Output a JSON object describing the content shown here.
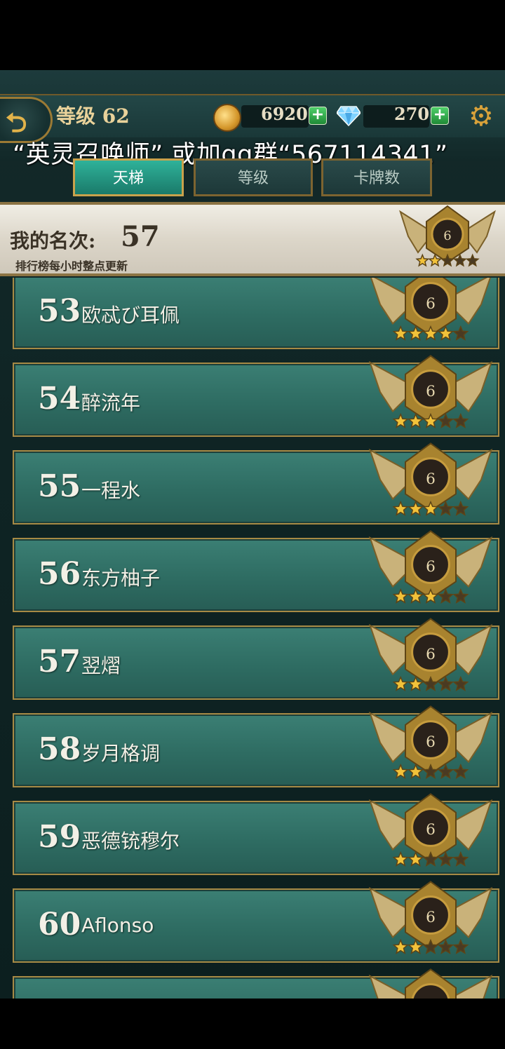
{
  "header": {
    "level_label": "等级 62",
    "gold": "6920",
    "gems": "270",
    "overlay_text": "“英灵召唤师” 或加qq群“567114341”"
  },
  "tabs": [
    {
      "label": "天梯",
      "active": true
    },
    {
      "label": "等级",
      "active": false
    },
    {
      "label": "卡牌数",
      "active": false
    }
  ],
  "my_rank": {
    "label": "我的名次:",
    "value": "57",
    "note": "排行榜每小时整点更新",
    "badge_level": "6",
    "stars_filled": 2,
    "stars_total": 5
  },
  "rows": [
    {
      "rank": "53",
      "name": "欧忒び耳佩",
      "badge_level": "6",
      "stars_filled": 4
    },
    {
      "rank": "54",
      "name": "醉流年",
      "badge_level": "6",
      "stars_filled": 3
    },
    {
      "rank": "55",
      "name": "一程水",
      "badge_level": "6",
      "stars_filled": 3
    },
    {
      "rank": "56",
      "name": "东方柚子",
      "badge_level": "6",
      "stars_filled": 3
    },
    {
      "rank": "57",
      "name": "翌熠",
      "badge_level": "6",
      "stars_filled": 2
    },
    {
      "rank": "58",
      "name": "岁月格调",
      "badge_level": "6",
      "stars_filled": 2
    },
    {
      "rank": "59",
      "name": "恶德铳穆尔",
      "badge_level": "6",
      "stars_filled": 2
    },
    {
      "rank": "60",
      "name": "Aflonso",
      "badge_level": "6",
      "stars_filled": 2
    },
    {
      "rank": "",
      "name": "",
      "badge_level": "",
      "stars_filled": 0
    }
  ],
  "icons": {
    "back": "back-arrow-icon",
    "coin": "gold-coin-icon",
    "gem": "diamond-icon",
    "settings": "gear-icon",
    "plus": "plus-icon"
  }
}
